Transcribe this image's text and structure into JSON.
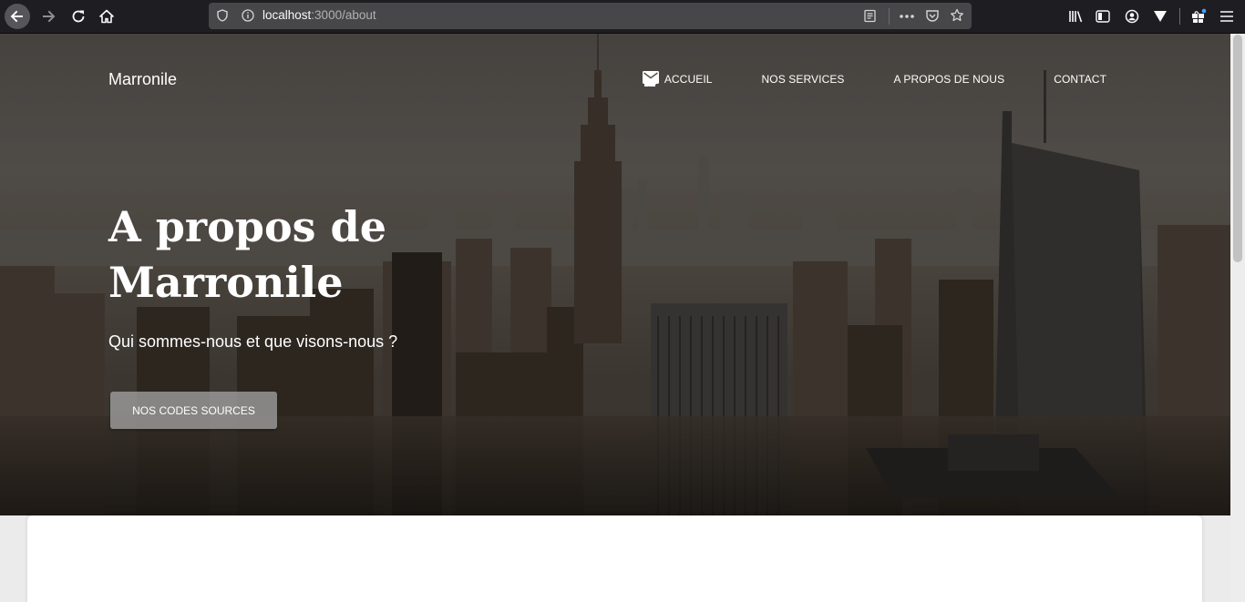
{
  "browser": {
    "url_host": "localhost",
    "url_rest": ":3000/about",
    "icons": [
      "back-icon",
      "forward-icon",
      "reload-icon",
      "home-icon",
      "shield-icon",
      "info-icon",
      "reader-view-icon",
      "more-icon",
      "pocket-icon",
      "bookmark-star-icon",
      "library-icon",
      "sidebar-icon",
      "account-icon",
      "vpn-icon",
      "extensions-icon",
      "menu-icon"
    ]
  },
  "nav": {
    "brand": "Marronile",
    "items": [
      {
        "label": "ACCUEIL",
        "icon": "home-icon"
      },
      {
        "label": "NOS SERVICES",
        "icon": "puzzle-icon"
      },
      {
        "label": "A PROPOS DE NOUS",
        "icon": "info-icon"
      },
      {
        "label": "CONTACT",
        "icon": "mail-icon"
      }
    ]
  },
  "hero": {
    "title_line1": "A propos de",
    "title_line2": "Marronile",
    "subtitle": "Qui sommes-nous et que visons-nous ?",
    "cta_label": "NOS CODES SOURCES"
  },
  "colors": {
    "chrome_bg": "#1e1e22",
    "urlbar_bg": "#474749",
    "button_bg": "#a0a0a0",
    "card_bg": "#ffffff"
  }
}
